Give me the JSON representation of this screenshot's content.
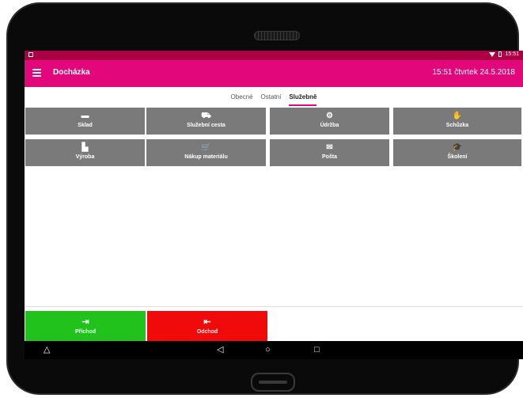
{
  "status_bar": {
    "time": "15:51"
  },
  "app_bar": {
    "title": "Docházka",
    "datetime": "15:51  čtvrtek 24.5.2018"
  },
  "tabs": [
    {
      "label": "Obecné",
      "active": false
    },
    {
      "label": "Ostatní",
      "active": false
    },
    {
      "label": "Služebně",
      "active": true
    }
  ],
  "tiles": [
    {
      "label": "Sklad",
      "icon": "box-icon",
      "glyph": "▬"
    },
    {
      "label": "Služební cesta",
      "icon": "car-icon",
      "glyph": "⛟"
    },
    {
      "label": "Údržba",
      "icon": "gears-icon",
      "glyph": "⚙"
    },
    {
      "label": "Schůzka",
      "icon": "handshake-icon",
      "glyph": "✋"
    },
    {
      "label": "Výroba",
      "icon": "factory-icon",
      "glyph": "▙"
    },
    {
      "label": "Nákup materiálu",
      "icon": "cart-icon",
      "glyph": "🛒"
    },
    {
      "label": "Pošta",
      "icon": "envelope-icon",
      "glyph": "✉"
    },
    {
      "label": "Školení",
      "icon": "graduation-cap-icon",
      "glyph": "🎓"
    }
  ],
  "actions": {
    "arrival": {
      "label": "Příchod",
      "glyph": "⇥",
      "color": "#21c21b"
    },
    "departure": {
      "label": "Odchod",
      "glyph": "⇤",
      "color": "#f00a0a"
    }
  },
  "nav": {
    "home_glyph": "△",
    "back_glyph": "◁",
    "circle_glyph": "○",
    "recents_glyph": "□"
  },
  "colors": {
    "accent": "#e2077a",
    "status": "#ad0044",
    "tile": "#7a7a7a"
  }
}
